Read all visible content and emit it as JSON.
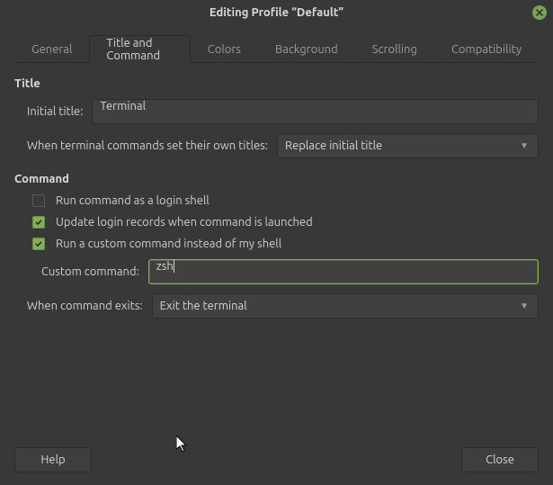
{
  "window": {
    "title": "Editing Profile “Default”"
  },
  "tabs": {
    "items": [
      {
        "label": "General"
      },
      {
        "label": "Title and Command"
      },
      {
        "label": "Colors"
      },
      {
        "label": "Background"
      },
      {
        "label": "Scrolling"
      },
      {
        "label": "Compatibility"
      }
    ],
    "active_index": 1
  },
  "title_section": {
    "heading": "Title",
    "initial_title_label": "Initial title:",
    "initial_title_value": "Terminal",
    "own_titles_label": "When terminal commands set their own titles:",
    "own_titles_value": "Replace initial title"
  },
  "command_section": {
    "heading": "Command",
    "login_shell_label": "Run command as a login shell",
    "login_shell_checked": false,
    "update_login_label": "Update login records when command is launched",
    "update_login_checked": true,
    "custom_cmd_enable_label": "Run a custom command instead of my shell",
    "custom_cmd_enable_checked": true,
    "custom_cmd_label": "Custom command:",
    "custom_cmd_value": "zsh",
    "exit_label": "When command exits:",
    "exit_value": "Exit the terminal"
  },
  "footer": {
    "help_label": "Help",
    "close_label": "Close"
  }
}
